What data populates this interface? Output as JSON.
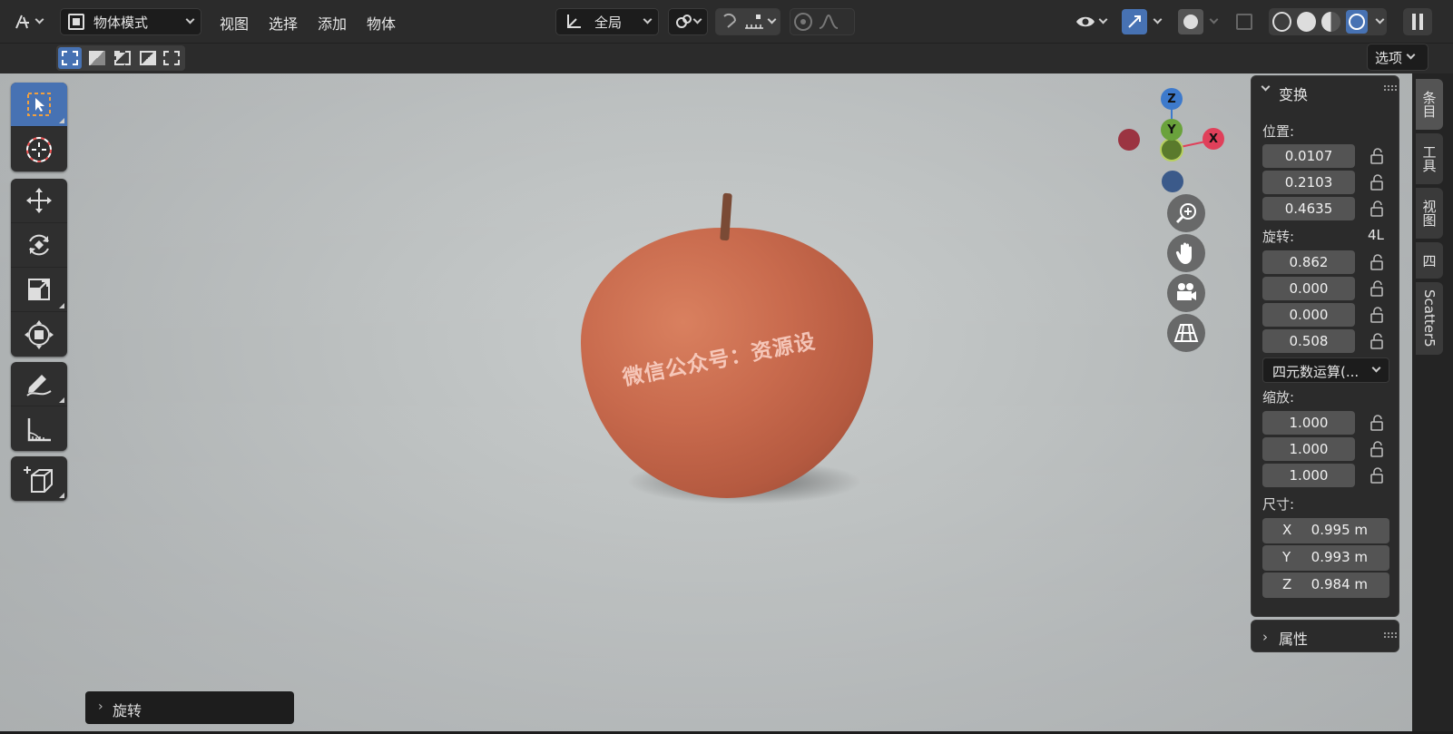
{
  "header": {
    "mode_label": "物体模式",
    "menus": [
      "视图",
      "选择",
      "添加",
      "物体"
    ],
    "transform_orientation": "全局",
    "options_label": "选项"
  },
  "viewport": {
    "watermark": "微信公众号：资源设",
    "gizmo": {
      "z": "Z",
      "y": "Y",
      "x": "X"
    }
  },
  "npanel": {
    "transform_title": "变换",
    "location_label": "位置:",
    "location": [
      "0.0107",
      "0.2103",
      "0.4635"
    ],
    "rotation_label": "旋转:",
    "rotation_mode_short": "4L",
    "rotation": [
      "0.862",
      "0.000",
      "0.000",
      "0.508"
    ],
    "rotation_mode": "四元数运算(...",
    "scale_label": "缩放:",
    "scale": [
      "1.000",
      "1.000",
      "1.000"
    ],
    "dimensions_label": "尺寸:",
    "dimensions": [
      {
        "axis": "X",
        "value": "0.995 m"
      },
      {
        "axis": "Y",
        "value": "0.993 m"
      },
      {
        "axis": "Z",
        "value": "0.984 m"
      }
    ],
    "properties_title": "属性"
  },
  "side_tabs": [
    "条目",
    "工具",
    "视图",
    "四",
    "Scatter5"
  ],
  "last_operator": "旋转",
  "colors": {
    "accent": "#4772b3",
    "panel": "#2b2b2b",
    "field": "#545454",
    "axis_x": "#e0405a",
    "axis_y": "#6aa23c",
    "axis_z": "#3d7acc"
  }
}
